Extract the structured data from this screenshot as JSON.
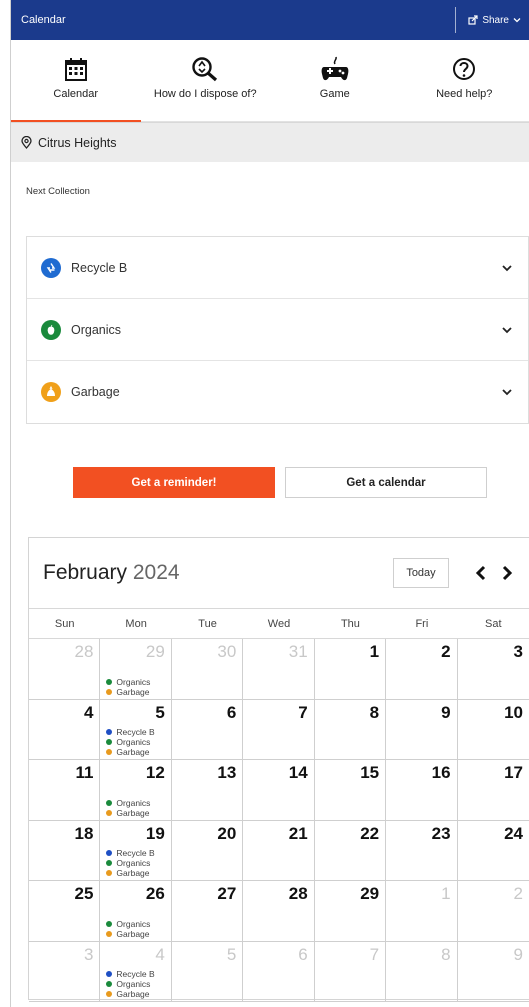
{
  "topbar": {
    "title": "Calendar",
    "share_label": "Share"
  },
  "nav": [
    {
      "label": "Calendar",
      "icon": "calendar-icon"
    },
    {
      "label": "How do I dispose of?",
      "icon": "search-recycle-icon"
    },
    {
      "label": "Game",
      "icon": "game-icon"
    },
    {
      "label": "Need help?",
      "icon": "help-icon"
    }
  ],
  "location": {
    "name": "Citrus Heights"
  },
  "next_collection": {
    "heading": "Next Collection"
  },
  "streams": [
    {
      "label": "Recycle B",
      "color": "#1f6bd1"
    },
    {
      "label": "Organics",
      "color": "#1a8a3c"
    },
    {
      "label": "Garbage",
      "color": "#f0a01a"
    }
  ],
  "buttons": {
    "reminder": "Get a reminder!",
    "calendar": "Get a calendar"
  },
  "calendar": {
    "month": "February",
    "year": "2024",
    "today_label": "Today",
    "weekdays": [
      "Sun",
      "Mon",
      "Tue",
      "Wed",
      "Thu",
      "Fri",
      "Sat"
    ],
    "event_colors": {
      "Recycle B": "#1f4fc4",
      "Organics": "#1a8a3c",
      "Garbage": "#e89a1e"
    },
    "days": [
      {
        "d": "28",
        "m": true,
        "e": []
      },
      {
        "d": "29",
        "m": true,
        "e": [
          "Organics",
          "Garbage"
        ]
      },
      {
        "d": "30",
        "m": true,
        "e": []
      },
      {
        "d": "31",
        "m": true,
        "e": []
      },
      {
        "d": "1",
        "m": false,
        "e": []
      },
      {
        "d": "2",
        "m": false,
        "e": []
      },
      {
        "d": "3",
        "m": false,
        "e": []
      },
      {
        "d": "4",
        "m": false,
        "e": []
      },
      {
        "d": "5",
        "m": false,
        "e": [
          "Recycle B",
          "Organics",
          "Garbage"
        ]
      },
      {
        "d": "6",
        "m": false,
        "e": []
      },
      {
        "d": "7",
        "m": false,
        "e": []
      },
      {
        "d": "8",
        "m": false,
        "e": []
      },
      {
        "d": "9",
        "m": false,
        "e": []
      },
      {
        "d": "10",
        "m": false,
        "e": []
      },
      {
        "d": "11",
        "m": false,
        "e": []
      },
      {
        "d": "12",
        "m": false,
        "e": [
          "Organics",
          "Garbage"
        ]
      },
      {
        "d": "13",
        "m": false,
        "e": []
      },
      {
        "d": "14",
        "m": false,
        "e": []
      },
      {
        "d": "15",
        "m": false,
        "e": []
      },
      {
        "d": "16",
        "m": false,
        "e": []
      },
      {
        "d": "17",
        "m": false,
        "e": []
      },
      {
        "d": "18",
        "m": false,
        "e": []
      },
      {
        "d": "19",
        "m": false,
        "e": [
          "Recycle B",
          "Organics",
          "Garbage"
        ]
      },
      {
        "d": "20",
        "m": false,
        "e": []
      },
      {
        "d": "21",
        "m": false,
        "e": []
      },
      {
        "d": "22",
        "m": false,
        "e": []
      },
      {
        "d": "23",
        "m": false,
        "e": []
      },
      {
        "d": "24",
        "m": false,
        "e": []
      },
      {
        "d": "25",
        "m": false,
        "e": []
      },
      {
        "d": "26",
        "m": false,
        "e": [
          "Organics",
          "Garbage"
        ]
      },
      {
        "d": "27",
        "m": false,
        "e": []
      },
      {
        "d": "28",
        "m": false,
        "e": []
      },
      {
        "d": "29",
        "m": false,
        "e": []
      },
      {
        "d": "1",
        "m": true,
        "e": []
      },
      {
        "d": "2",
        "m": true,
        "e": []
      },
      {
        "d": "3",
        "m": true,
        "e": []
      },
      {
        "d": "4",
        "m": true,
        "e": [
          "Recycle B",
          "Organics",
          "Garbage"
        ]
      },
      {
        "d": "5",
        "m": true,
        "e": []
      },
      {
        "d": "6",
        "m": true,
        "e": []
      },
      {
        "d": "7",
        "m": true,
        "e": []
      },
      {
        "d": "8",
        "m": true,
        "e": []
      },
      {
        "d": "9",
        "m": true,
        "e": []
      }
    ]
  }
}
